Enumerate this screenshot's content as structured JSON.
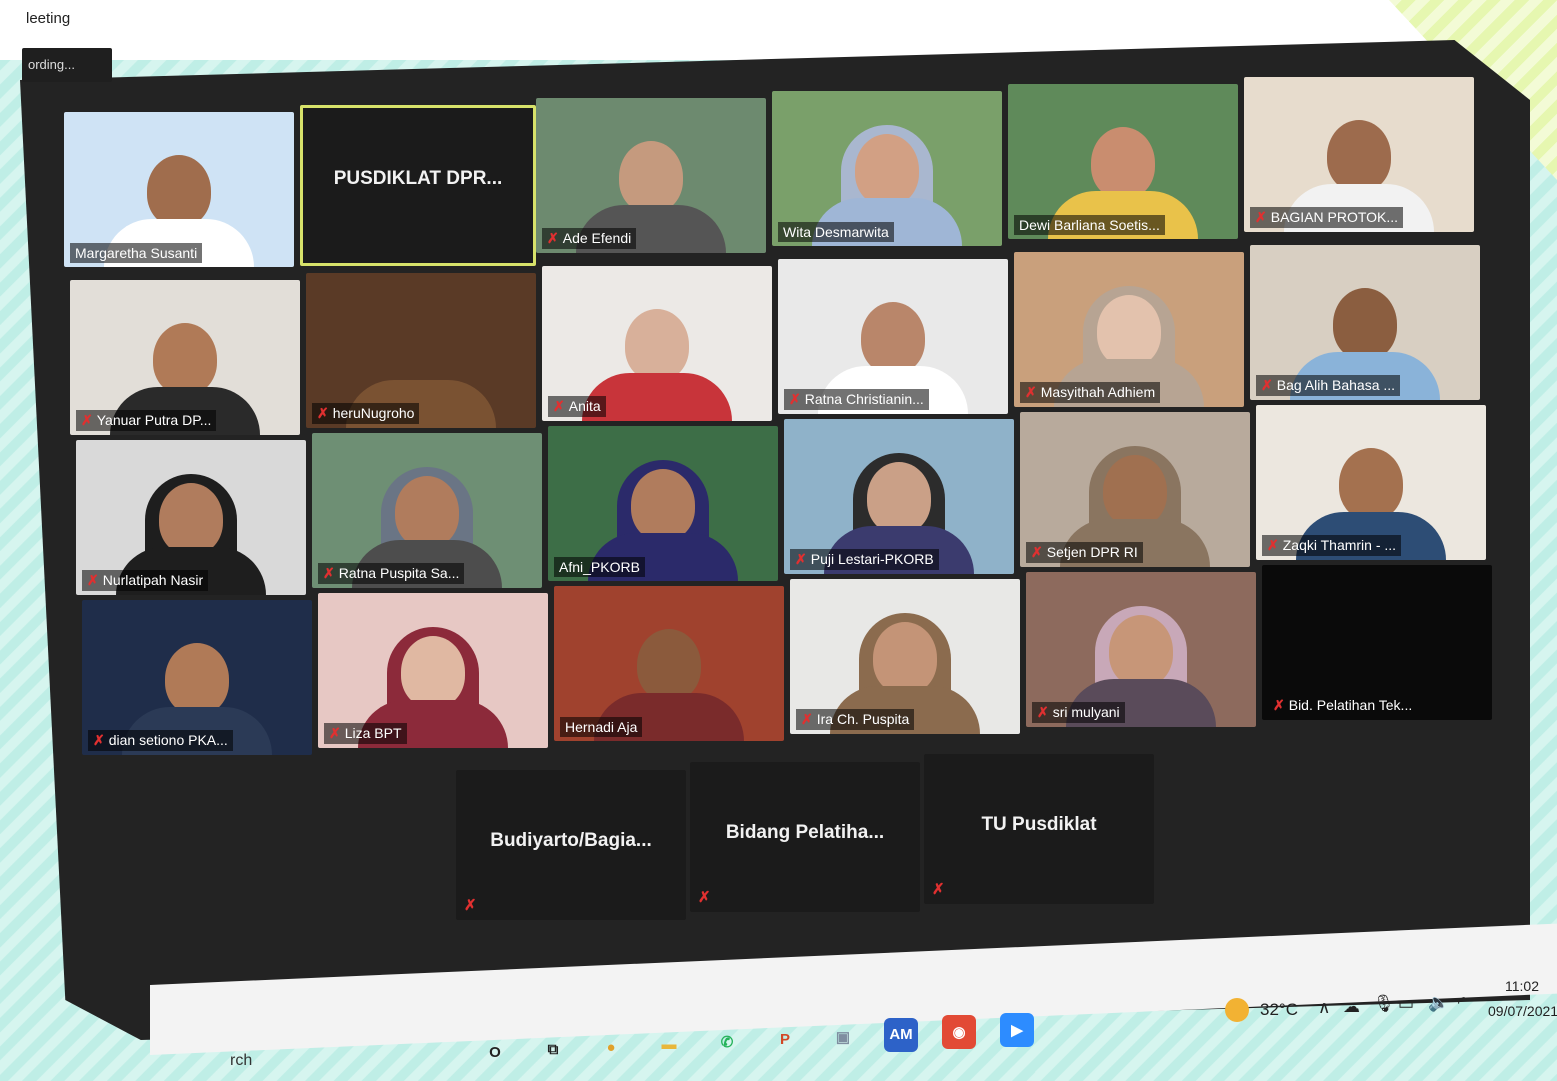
{
  "window": {
    "title": "leeting",
    "recording_label": "ording..."
  },
  "participants": [
    {
      "name": "Margaretha Susanti",
      "kind": "video",
      "bg": "#cfe3f5",
      "skin": "#a06d4d",
      "wear": "#ffffff",
      "muted": false
    },
    {
      "name": "PUSDIKLAT DPR...",
      "kind": "name-only",
      "active": true
    },
    {
      "name": "Ade Efendi",
      "kind": "video",
      "bg": "#6d8a6f",
      "skin": "#c59a7e",
      "wear": "#555555",
      "muted": true
    },
    {
      "name": "Wita Desmarwita",
      "kind": "video",
      "bg": "#7aa06a",
      "skin": "#d2a084",
      "wear": "#9fb6d6",
      "muted": false,
      "hijab": "#a9b7cf"
    },
    {
      "name": "Dewi Barliana Soetis...",
      "kind": "video",
      "bg": "#5f8a5a",
      "skin": "#c98d6f",
      "wear": "#e9c24a",
      "muted": false
    },
    {
      "name": "BAGIAN PROTOK...",
      "kind": "video",
      "bg": "#e7dccd",
      "skin": "#9d6b4d",
      "wear": "#f2f2f2",
      "muted": true
    },
    {
      "name": "Yanuar Putra DP...",
      "kind": "video",
      "bg": "#e2ded8",
      "skin": "#b07a57",
      "wear": "#2a2a2a",
      "muted": true
    },
    {
      "name": "heruNugroho",
      "kind": "video",
      "bg": "#5a3a26",
      "skin": "#5a3a26",
      "wear": "#7a5232",
      "muted": true,
      "nohead": true
    },
    {
      "name": "Anita",
      "kind": "video",
      "bg": "#ece9e6",
      "skin": "#d8b09a",
      "wear": "#c8343a",
      "muted": true
    },
    {
      "name": "Ratna Christianin...",
      "kind": "video",
      "bg": "#e9e9e9",
      "skin": "#b9866a",
      "wear": "#ffffff",
      "muted": true
    },
    {
      "name": "Masyithah Adhiem",
      "kind": "video",
      "bg": "#c9a07c",
      "skin": "#e3c2ad",
      "wear": "#b7a493",
      "muted": true,
      "hijab": "#b7a493"
    },
    {
      "name": "Bag Alih Bahasa ...",
      "kind": "video",
      "bg": "#d8cfc2",
      "skin": "#8b5e40",
      "wear": "#8ab3d9",
      "muted": true
    },
    {
      "name": "Nurlatipah Nasir",
      "kind": "video",
      "bg": "#d9d9d9",
      "skin": "#b07c5d",
      "wear": "#1e1e1e",
      "muted": true,
      "hijab": "#1e1e1e"
    },
    {
      "name": "Ratna Puspita Sa...",
      "kind": "video",
      "bg": "#6e8f74",
      "skin": "#b07c5d",
      "wear": "#4d4d4d",
      "muted": true,
      "hijab": "#6a7585"
    },
    {
      "name": "Afni_PKORB",
      "kind": "video",
      "bg": "#3d6e47",
      "skin": "#b07c5d",
      "wear": "#2b2a6a",
      "muted": false,
      "hijab": "#2b2a6a"
    },
    {
      "name": "Puji Lestari-PKORB",
      "kind": "video",
      "bg": "#8fb2c9",
      "skin": "#caa087",
      "wear": "#3b3b6e",
      "muted": true,
      "hijab": "#2c2c2c"
    },
    {
      "name": "Setjen DPR RI",
      "kind": "video",
      "bg": "#b8aa9c",
      "skin": "#a07050",
      "wear": "#8a7560",
      "muted": true,
      "hijab": "#8a7560"
    },
    {
      "name": "Zaqki Thamrin - ...",
      "kind": "video",
      "bg": "#ece7df",
      "skin": "#a4714f",
      "wear": "#2d4d75",
      "muted": true
    },
    {
      "name": "dian setiono PKA...",
      "kind": "video",
      "bg": "#1f2d4a",
      "skin": "#b07a57",
      "wear": "#2b3a56",
      "muted": true
    },
    {
      "name": "Liza BPT",
      "kind": "video",
      "bg": "#e7c8c4",
      "skin": "#e0b8a2",
      "wear": "#8c2a3a",
      "muted": true,
      "hijab": "#8c2a3a"
    },
    {
      "name": "Hernadi Aja",
      "kind": "video",
      "bg": "#a0422e",
      "skin": "#8b5a3c",
      "wear": "#7a2b2b",
      "muted": false
    },
    {
      "name": "Ira Ch. Puspita",
      "kind": "video",
      "bg": "#e8e8e6",
      "skin": "#c49477",
      "wear": "#8b6b4e",
      "muted": true,
      "hijab": "#8b6b4e"
    },
    {
      "name": "sri mulyani",
      "kind": "video",
      "bg": "#8d6a5d",
      "skin": "#c79678",
      "wear": "#5a4b5a",
      "muted": true,
      "hijab": "#c8a8b8"
    },
    {
      "name": "Bid. Pelatihan Tek...",
      "kind": "black",
      "muted": true
    },
    {
      "name": "Budiyarto/Bagia...",
      "kind": "name-only",
      "muted": true
    },
    {
      "name": "Bidang  Pelatiha...",
      "kind": "name-only",
      "muted": true
    },
    {
      "name": "TU Pusdiklat",
      "kind": "name-only",
      "muted": true
    }
  ],
  "taskbar": {
    "search_text": "rch",
    "apps": [
      {
        "icon": "cortana-icon",
        "glyph": "O",
        "color": "#222222"
      },
      {
        "icon": "task-view-icon",
        "glyph": "⧉",
        "color": "#222222"
      },
      {
        "icon": "chrome-icon",
        "glyph": "●",
        "color": "#e1a12b"
      },
      {
        "icon": "file-explorer-icon",
        "glyph": "▬",
        "color": "#e8b73a"
      },
      {
        "icon": "whatsapp-icon",
        "glyph": "✆",
        "color": "#25b35a"
      },
      {
        "icon": "powerpoint-icon",
        "glyph": "P",
        "color": "#d24726"
      },
      {
        "icon": "screen-icon",
        "glyph": "▣",
        "color": "#7f8ea0"
      },
      {
        "icon": "am-app-icon",
        "glyph": "AM",
        "color": "#2d62c8"
      },
      {
        "icon": "game-app-icon",
        "glyph": "◉",
        "color": "#e24a35"
      },
      {
        "icon": "zoom-icon",
        "glyph": "▶",
        "color": "#2d8cff"
      }
    ],
    "temperature": "32°C",
    "time": "11:02",
    "date": "09/07/2021"
  }
}
